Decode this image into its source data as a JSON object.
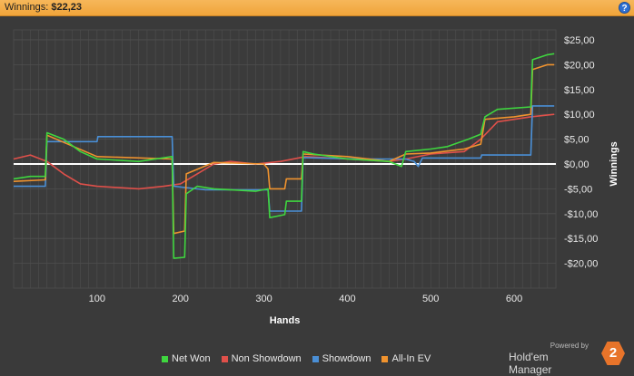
{
  "header": {
    "label": "Winnings:",
    "value": "$22,23",
    "help_icon": "?"
  },
  "brand": {
    "powered_by": "Powered by",
    "name": "Hold'em Manager",
    "logo_text": "2"
  },
  "colors": {
    "background": "#3a3a3a",
    "grid": "#4f4f4f",
    "zero_line": "#ffffff",
    "net_won": "#3fd63f",
    "non_showdown": "#e0504a",
    "showdown": "#4a8fd6",
    "all_in_ev": "#f0932e"
  },
  "chart_data": {
    "type": "line",
    "title": "",
    "xlabel": "Hands",
    "ylabel": "Winnings",
    "xlim": [
      0,
      650
    ],
    "ylim": [
      -25,
      27
    ],
    "x_ticks": [
      100,
      200,
      300,
      400,
      500,
      600
    ],
    "y_ticks": [
      25,
      20,
      15,
      10,
      5,
      0,
      -5,
      -10,
      -15,
      -20
    ],
    "y_tick_labels": [
      "$25,00",
      "$20,00",
      "$15,00",
      "$10,00",
      "$5,00",
      "$0,00",
      "-$5,00",
      "-$10,00",
      "-$15,00",
      "-$20,00"
    ],
    "grid": true,
    "legend_position": "bottom",
    "series": [
      {
        "name": "Net Won",
        "color": "#3fd63f",
        "points": [
          [
            0,
            -3
          ],
          [
            20,
            -2.5
          ],
          [
            38,
            -2.5
          ],
          [
            40,
            6.3
          ],
          [
            60,
            5
          ],
          [
            80,
            2.5
          ],
          [
            100,
            1
          ],
          [
            150,
            0.5
          ],
          [
            190,
            1.5
          ],
          [
            192,
            -19
          ],
          [
            205,
            -18.8
          ],
          [
            207,
            -6
          ],
          [
            220,
            -4.5
          ],
          [
            240,
            -5
          ],
          [
            290,
            -5.5
          ],
          [
            305,
            -5
          ],
          [
            307,
            -10.8
          ],
          [
            325,
            -10.2
          ],
          [
            327,
            -7.5
          ],
          [
            345,
            -7.5
          ],
          [
            347,
            2.5
          ],
          [
            360,
            2
          ],
          [
            400,
            1
          ],
          [
            450,
            0.5
          ],
          [
            465,
            -0.5
          ],
          [
            470,
            2.5
          ],
          [
            500,
            3
          ],
          [
            520,
            3.5
          ],
          [
            545,
            5
          ],
          [
            560,
            6
          ],
          [
            565,
            9.5
          ],
          [
            580,
            11
          ],
          [
            620,
            11.5
          ],
          [
            622,
            21
          ],
          [
            640,
            22
          ],
          [
            648,
            22.2
          ]
        ]
      },
      {
        "name": "Non Showdown",
        "color": "#e0504a",
        "points": [
          [
            0,
            1
          ],
          [
            20,
            1.8
          ],
          [
            40,
            0.5
          ],
          [
            60,
            -2
          ],
          [
            80,
            -4
          ],
          [
            100,
            -4.5
          ],
          [
            150,
            -5
          ],
          [
            180,
            -4.5
          ],
          [
            200,
            -4
          ],
          [
            220,
            -2
          ],
          [
            240,
            0
          ],
          [
            260,
            0.5
          ],
          [
            290,
            0
          ],
          [
            320,
            0.5
          ],
          [
            350,
            1.5
          ],
          [
            400,
            1
          ],
          [
            450,
            0.5
          ],
          [
            470,
            1
          ],
          [
            500,
            2
          ],
          [
            540,
            2.5
          ],
          [
            560,
            5
          ],
          [
            580,
            8.5
          ],
          [
            620,
            9.5
          ],
          [
            648,
            10
          ]
        ]
      },
      {
        "name": "Showdown",
        "color": "#4a8fd6",
        "points": [
          [
            0,
            -4.5
          ],
          [
            38,
            -4.5
          ],
          [
            40,
            4.5
          ],
          [
            100,
            4.5
          ],
          [
            101,
            5.5
          ],
          [
            190,
            5.5
          ],
          [
            192,
            -4.5
          ],
          [
            230,
            -5.2
          ],
          [
            300,
            -5.2
          ],
          [
            305,
            -5.2
          ],
          [
            307,
            -9.5
          ],
          [
            345,
            -9.5
          ],
          [
            347,
            1.3
          ],
          [
            410,
            1
          ],
          [
            470,
            1
          ],
          [
            480,
            0.5
          ],
          [
            485,
            -0.5
          ],
          [
            490,
            1.2
          ],
          [
            560,
            1.2
          ],
          [
            561,
            1.8
          ],
          [
            620,
            1.8
          ],
          [
            622,
            11.7
          ],
          [
            648,
            11.7
          ]
        ]
      },
      {
        "name": "All-In EV",
        "color": "#f0932e",
        "points": [
          [
            0,
            -3.5
          ],
          [
            38,
            -3.2
          ],
          [
            40,
            5.8
          ],
          [
            100,
            1.5
          ],
          [
            190,
            1
          ],
          [
            192,
            -14
          ],
          [
            205,
            -13.5
          ],
          [
            207,
            -2
          ],
          [
            240,
            0.3
          ],
          [
            300,
            0
          ],
          [
            305,
            -1
          ],
          [
            307,
            -5
          ],
          [
            325,
            -5
          ],
          [
            327,
            -3
          ],
          [
            345,
            -3
          ],
          [
            347,
            2
          ],
          [
            400,
            1.5
          ],
          [
            450,
            0.5
          ],
          [
            470,
            2
          ],
          [
            500,
            2.2
          ],
          [
            540,
            3
          ],
          [
            560,
            4
          ],
          [
            565,
            9
          ],
          [
            600,
            9.5
          ],
          [
            620,
            10
          ],
          [
            622,
            19
          ],
          [
            640,
            20
          ],
          [
            648,
            20
          ]
        ]
      }
    ]
  }
}
